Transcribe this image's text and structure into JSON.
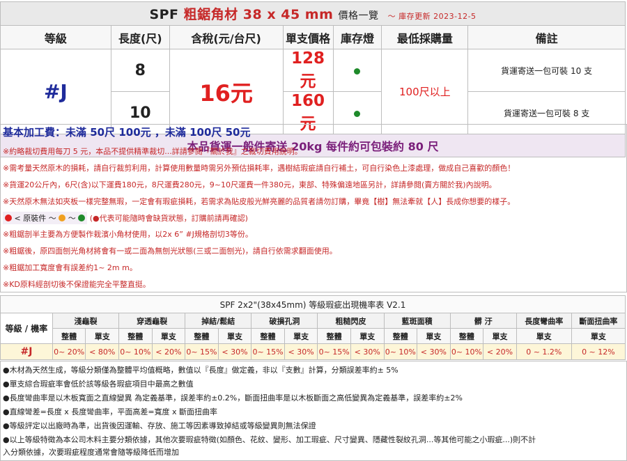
{
  "title": {
    "product_prefix": "SPF",
    "product_name": "粗鋸角材",
    "size": "38 x 45 mm",
    "label": "價格一覽",
    "updated": "～ 庫存更新 2023-12-5"
  },
  "headers": [
    "等級",
    "長度(尺)",
    "含稅(元/台尺)",
    "單支價格",
    "庫存燈",
    "最低採購量",
    "備註"
  ],
  "grade": "#J",
  "rows": [
    {
      "length": "8",
      "unit_price": "128元",
      "note": "貨運寄送一包可裝 10 支"
    },
    {
      "length": "10",
      "unit_price": "160元",
      "note": "貨運寄送一包可裝 8 支"
    }
  ],
  "tax_price": "16元",
  "min_purchase": "100尺以上",
  "stock_color": "#1e8a2a",
  "shipping_note": "本品貨運一般件寄送 20kg 每件約可包裝約 80 尺",
  "processing_fee": "基本加工費：未滿 50尺 100元 ，未滿 100尺 50元",
  "info_lines": [
    "※約略裁切費用每刀 5 元，本品不提供精準裁切...詳請參閱『關於我』之裁切費用說明。",
    "※需考量天然原木的損耗，請自行裁剪利用，計算使用數量時需另外預估損耗率，遇樹結瑕疵請自行補土，可自行染色上漆處理，做成自己喜歡的顏色！",
    "※貨運20公斤內，6尺(含)以下運費180元，8尺運費280元，9~10尺運費一件380元，東部、特殊偏遠地區另計，詳請參閱(賣方關於我)內說明。",
    "※天然原木無法如夾板一樣完整無瑕，一定會有瑕疵損耗，若需求為貼皮般光鮮亮麗的品質者請勿訂購，畢竟【樹】無法牽就【人】長成你想要的樣子。"
  ],
  "legend": {
    "text": "< 原裝件 ～",
    "sep": "～",
    "warning": "(●代表可能隨時會缺貨狀態，訂購前請再確認)",
    "colors": [
      "#e02020",
      "#f0a020",
      "#1e8a2a"
    ]
  },
  "red_lines": [
    "※粗鋸剖半主要為方便製作栽濱小角材使用，以2x 6”  #J規格剖切3等份。",
    "※粗鋸後，原四面刨光角材將會有一或二面為無刨光狀態(三或二面刨光)，請自行依需求翻面使用。",
    "※粗鋸加工寬度會有誤差約1~ 2m m。",
    "※KD原料經剖切後不保證能完全平整直挺。"
  ],
  "defect_table": {
    "title": "SPF 2x2\"(38x45mm) 等級瑕疵出現機率表 V2.1",
    "row_header": "等級 / 機率",
    "categories": [
      "淺龜裂",
      "穿透龜裂",
      "掉結/鬆結",
      "破損孔洞",
      "粗糙閃皮",
      "藍斑面積",
      "髒 汙",
      "長度彎曲率",
      "斷面扭曲率"
    ],
    "sub_whole": "整體",
    "sub_single": "單支",
    "grade": "#J",
    "values": [
      "0~ 20%",
      "< 80%",
      "0~ 10%",
      "< 20%",
      "0~ 15%",
      "< 30%",
      "0~ 15%",
      "< 30%",
      "0~ 15%",
      "< 30%",
      "0~ 10%",
      "< 30%",
      "0~ 10%",
      "< 20%",
      "0 ~ 1.2%",
      "0 ~ 12%"
    ]
  },
  "footnotes": [
    "●木材為天然生成，等級分類僅為整體平均值概略，數值以『長度』做定義，非以『支數』計算，分類誤差率約± 5%",
    "●單支綜合瑕疵率會低於該等級各瑕疵項目中最高之數值",
    "●長度彎曲率是以木板寬面之直線變異 為定義基準，誤差率約±0.2%，斷面扭曲率是以木板斷面之高低變異為定義基準，誤差率約±2%",
    "●直線彎差=長度 x 長度彎曲率，平面高差=寬度 x 斷面扭曲率",
    "●等級評定以出廠時為準，出貨後因運輸、存放、施工等因素導致掉結或等級變異則無法保證",
    "●以上等級特徵為本公司木料主要分類依據，其他次要瑕疵特徵(如顏色、花紋、變形、加工瑕疵、尺寸變異、隱藏性裂紋孔洞...等其他可能之小瑕疵...)則不計",
    "入分類依據，次要瑕疵程度通常會隨等級降低而增加"
  ]
}
